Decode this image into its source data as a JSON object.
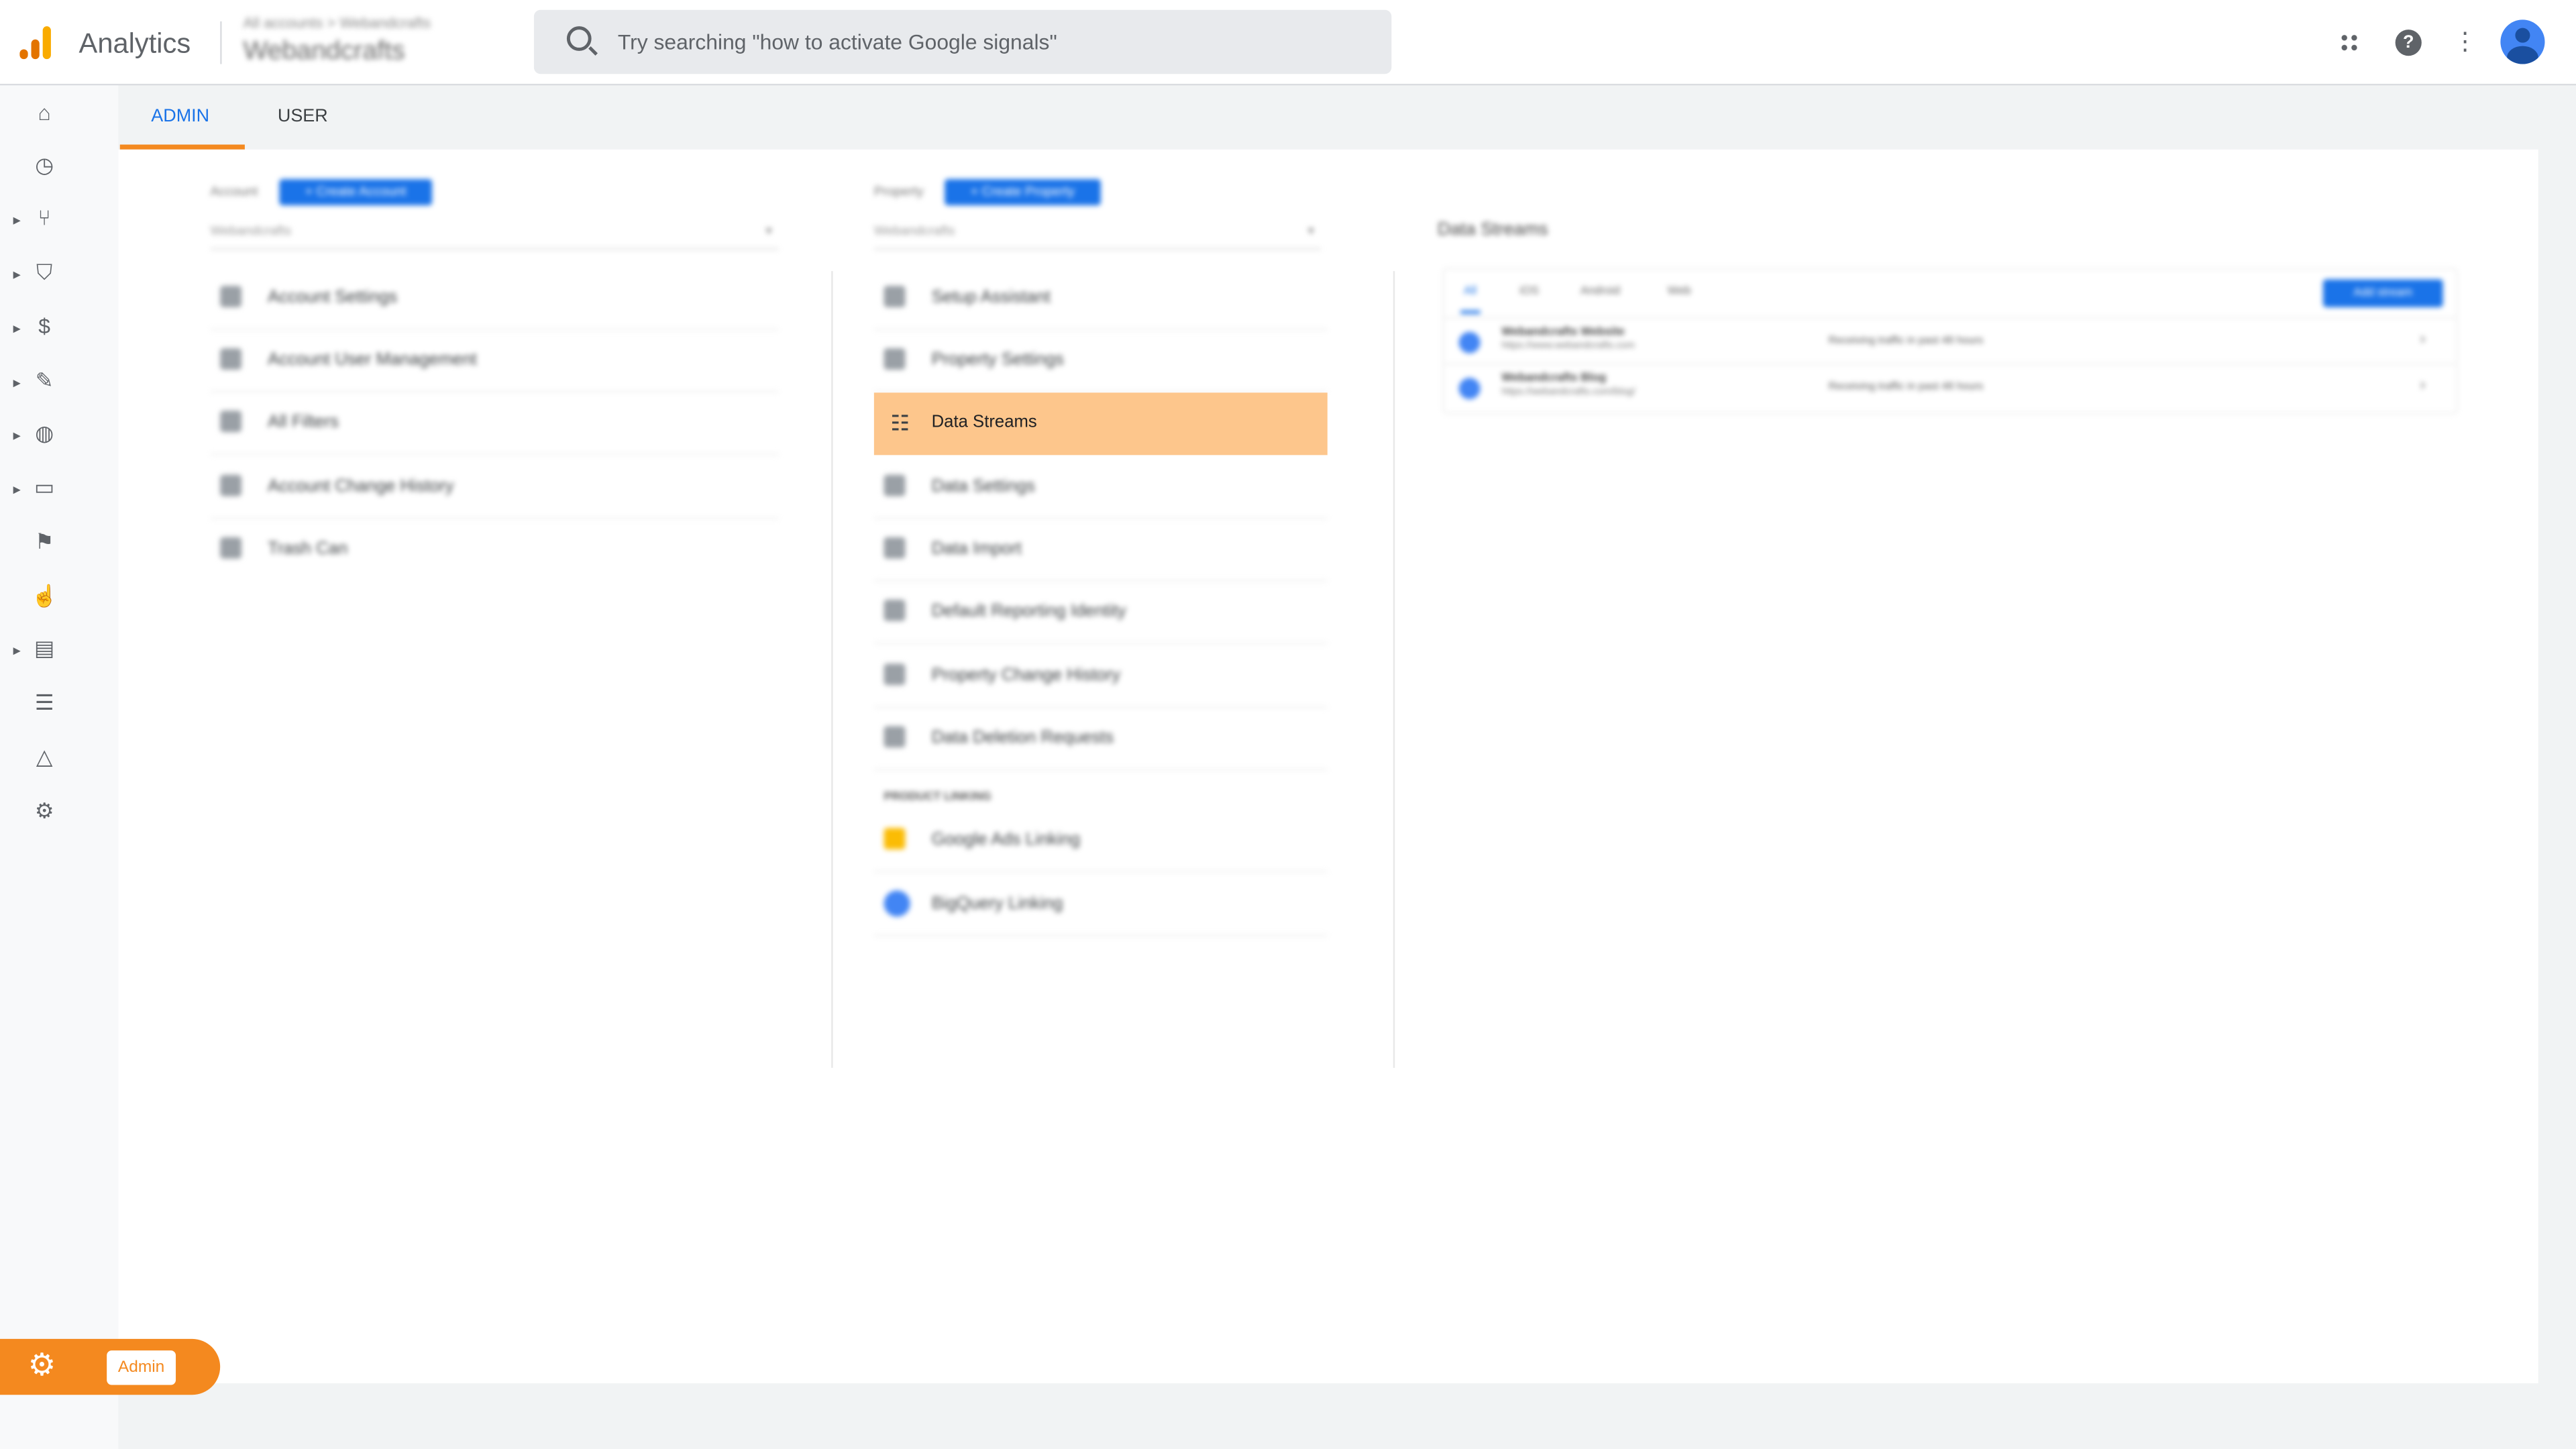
{
  "header": {
    "app_title": "Analytics",
    "breadcrumb": "All accounts > Webandcrafts",
    "account_name": "Webandcrafts",
    "search_placeholder": "Try searching \"how to activate Google signals\"",
    "avatar_color": "#4285f4"
  },
  "tabs": [
    {
      "label": "ADMIN",
      "active": true
    },
    {
      "label": "USER",
      "active": false
    }
  ],
  "account": {
    "label": "Account",
    "create_button": "+ Create Account",
    "selected": "Webandcrafts",
    "items": [
      "Account Settings",
      "Account User Management",
      "All Filters",
      "Account Change History",
      "Trash Can"
    ]
  },
  "property": {
    "label": "Property",
    "create_button": "+ Create Property",
    "selected": "Webandcrafts",
    "items": [
      "Setup Assistant",
      "Property Settings",
      "Data Streams",
      "Data Settings",
      "Data Import",
      "Default Reporting Identity",
      "Property Change History",
      "Data Deletion Requests"
    ],
    "active_item": "Data Streams",
    "section_label": "PRODUCT LINKING",
    "linking": [
      "Google Ads Linking",
      "BigQuery Linking"
    ]
  },
  "streams": {
    "title": "Data Streams",
    "tabs": [
      "All",
      "iOS",
      "Android",
      "Web"
    ],
    "add_button": "Add stream",
    "rows": [
      {
        "name": "Webandcrafts Website",
        "url": "https://www.webandcrafts.com",
        "status": "Receiving traffic in past 48 hours"
      },
      {
        "name": "Webandcrafts Blog",
        "url": "https://webandcrafts.com/blog/",
        "status": "Receiving traffic in past 48 hours"
      }
    ]
  },
  "footer": {
    "admin_label": "Admin"
  },
  "colors": {
    "accent": "#f4891f",
    "highlight": "#fdc68c",
    "blue": "#1a73e8"
  }
}
